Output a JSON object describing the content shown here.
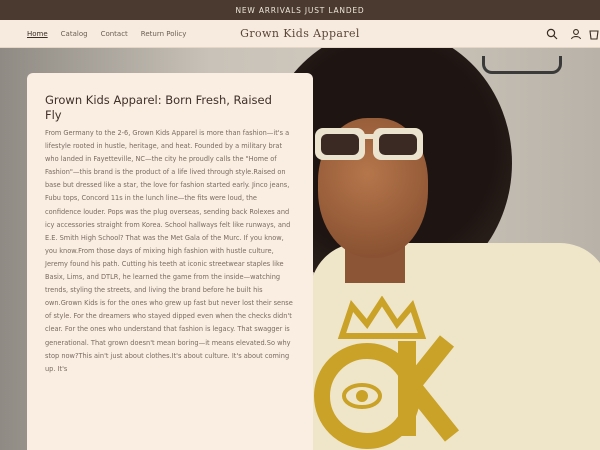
{
  "announcement": "NEW ARRIVALS JUST LANDED",
  "nav": {
    "links": [
      "Home",
      "Catalog",
      "Contact",
      "Return Policy"
    ],
    "active": "Home"
  },
  "brand": "Grown Kids Apparel",
  "icons": [
    "search-icon",
    "account-icon",
    "cart-icon"
  ],
  "card": {
    "title": "Grown Kids Apparel: Born Fresh, Raised Fly",
    "body": "From Germany to the 2-6, Grown Kids Apparel is more than fashion—it's a lifestyle rooted in hustle, heritage, and heat. Founded by a military brat who landed in Fayetteville, NC—the city he proudly calls the \"Home of Fashion\"—this brand is the product of a life lived through style.Raised on base but dressed like a star, the love for fashion started early. Jinco jeans, Fubu tops, Concord 11s in the lunch line—the fits were loud, the confidence louder. Pops was the plug overseas, sending back Rolexes and icy accessories straight from Korea. School hallways felt like runways, and E.E. Smith High School? That was the Met Gala of the Murc. If you know, you know.From those days of mixing high fashion with hustle culture, Jeremy found his path. Cutting his teeth at iconic streetwear staples like Basix, Lims, and DTLR, he learned the game from the inside—watching trends, styling the streets, and living the brand before he built his own.Grown Kids is for the ones who grew up fast but never lost their sense of style. For the dreamers who stayed dipped even when the checks didn't clear. For the ones who understand that fashion is legacy. That swagger is generational. That grown doesn't mean boring—it means elevated.So why stop now?This ain't just about clothes.It's about culture. It's about coming up. It's"
  },
  "colors": {
    "announcement_bg": "#4a3a30",
    "header_bg": "#f7ebe0",
    "card_bg": "#faeee3",
    "logo_gold": "#c9a227"
  }
}
